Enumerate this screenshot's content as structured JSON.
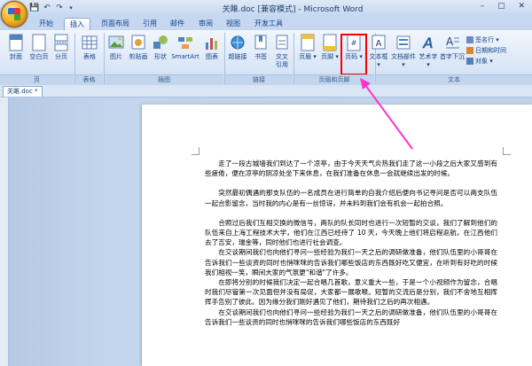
{
  "window": {
    "title": "关雎.doc [兼容模式] - Microsoft Word",
    "controls": "– ▢ ✕"
  },
  "quick_access": [
    "save-icon",
    "undo-icon",
    "redo-icon"
  ],
  "tabs": [
    {
      "label": "开始",
      "active": false
    },
    {
      "label": "插入",
      "active": true
    },
    {
      "label": "页面布局",
      "active": false
    },
    {
      "label": "引用",
      "active": false
    },
    {
      "label": "邮件",
      "active": false
    },
    {
      "label": "审阅",
      "active": false
    },
    {
      "label": "视图",
      "active": false
    },
    {
      "label": "开发工具",
      "active": false
    }
  ],
  "ribbon": {
    "buttons": {
      "cover": "封面",
      "blank_page": "空白页",
      "page_break": "分页",
      "table": "表格",
      "picture": "图片",
      "clipart": "剪贴画",
      "shapes": "形状",
      "smartart": "SmartArt",
      "chart": "图表",
      "hyperlink": "超链接",
      "bookmark": "书签",
      "cross_ref_1": "交叉",
      "cross_ref_2": "引用",
      "header": "页眉",
      "footer": "页脚",
      "page_number": "页码",
      "textbox": "文本框",
      "quick_parts": "文档部件",
      "wordart": "艺术字",
      "dropcap": "首字下沉",
      "signature_line": "签名行",
      "datetime": "日期和时间",
      "object": "对象"
    },
    "groups": {
      "pages": "页",
      "tables": "表格",
      "illustrations": "插图",
      "links": "链接",
      "header_footer": "页眉和页脚",
      "text": "文本"
    }
  },
  "document": {
    "tab_label": "关雎.doc *",
    "paragraphs": [
      "走了一段古城墙我们到达了一个凉亭，由于今天天气炎热我们走了这一小段之后大家又感到有些疲倦，便在凉亭的阴凉处坐下来休息，在我们准备在休息一会就继续出发的时候。",
      "突然最初偶遇的那支队伍的一名成员在进行简单的自我介绍后便向书记寻问是否可以两支队伍一起合影留念，当时我的内心是有一丝惊讶，并未料到我们会有机会一起拍合照。",
      "合照过后我们互相交换的微信号，两队的队长同时也进行一次短暂的交谈，我们了解到他们的队伍来自上海工程技术大学，他们在江西已经待了 10 天，今天晚上他们将启程返航，在江西他们去了吉安，瑞金等，同时他们也进行社会调查。",
      "在交谈期间我们也向他们寻问一些经验为我们一天之后的调研做准备，他们队伍里的小哥哥在告诉我们一些谈资的同时也悄咪咪的告诉我们哪些饭店的东西既好吃又便宜，在听到有好吃的时候我们相视一笑，瞬间大家的气氛更\"和谐\"了许多。",
      "在即将分别的时候我们决定一起合唱几首歌，意义重大一些，于是一个小视频作为留念，合唱时我们尽管第一次见面但并没有局促，大家都一展歌喉。短暂的交流后是分别，我们不舍地互相挥挥手告别了彼此。因为缘分我们刚好遇见了他们，期待我们之后的再次相遇。",
      "在交谈期间我们也向他们寻问一些经验为我们一天之后的调研做准备，他们队伍里的小哥哥在告诉我们一些谈资的同时也悄咪咪的告诉我们哪些饭店的东西既好"
    ]
  },
  "annotation": {
    "highlight_color": "#ff0000",
    "arrow_color": "#ff33cc"
  }
}
